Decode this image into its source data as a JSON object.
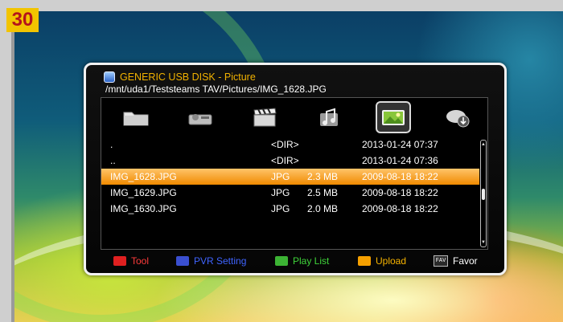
{
  "badge": "30",
  "colors": {
    "title_accent": "#f2b200",
    "highlight": "#f7a300",
    "badge_bg": "#f2c400",
    "badge_text": "#b4131c"
  },
  "panel": {
    "title": "GENERIC USB DISK - Picture",
    "path": "/mnt/uda1/Teststeams TAV/Pictures/IMG_1628.JPG"
  },
  "categories": [
    {
      "icon": "folder-icon",
      "selected": false
    },
    {
      "icon": "hard-drive-icon",
      "selected": false
    },
    {
      "icon": "film-clapper-icon",
      "selected": false
    },
    {
      "icon": "music-icon",
      "selected": false
    },
    {
      "icon": "picture-icon",
      "selected": true
    },
    {
      "icon": "download-icon",
      "selected": false
    }
  ],
  "files": [
    {
      "name": ".",
      "type": "<DIR>",
      "size": "",
      "date": "2013-01-24 07:37"
    },
    {
      "name": "..",
      "type": "<DIR>",
      "size": "",
      "date": "2013-01-24 07:36"
    },
    {
      "name": "IMG_1628.JPG",
      "type": "JPG",
      "size": "2.3 MB",
      "date": "2009-08-18 18:22",
      "selected": true
    },
    {
      "name": "IMG_1629.JPG",
      "type": "JPG",
      "size": "2.5 MB",
      "date": "2009-08-18 18:22"
    },
    {
      "name": "IMG_1630.JPG",
      "type": "JPG",
      "size": "2.0 MB",
      "date": "2009-08-18 18:22"
    }
  ],
  "footer": [
    {
      "label": "Tool",
      "color": "#e02020",
      "text_color": "#ff3b3b"
    },
    {
      "label": "PVR Setting",
      "color": "#3a4fd0",
      "text_color": "#3f64ff"
    },
    {
      "label": "Play List",
      "color": "#3cb334",
      "text_color": "#3fd43a"
    },
    {
      "label": "Upload",
      "color": "#f5a000",
      "text_color": "#f7b400"
    },
    {
      "label": "Favor",
      "key": "FAV",
      "text_color": "#ffffff"
    }
  ]
}
